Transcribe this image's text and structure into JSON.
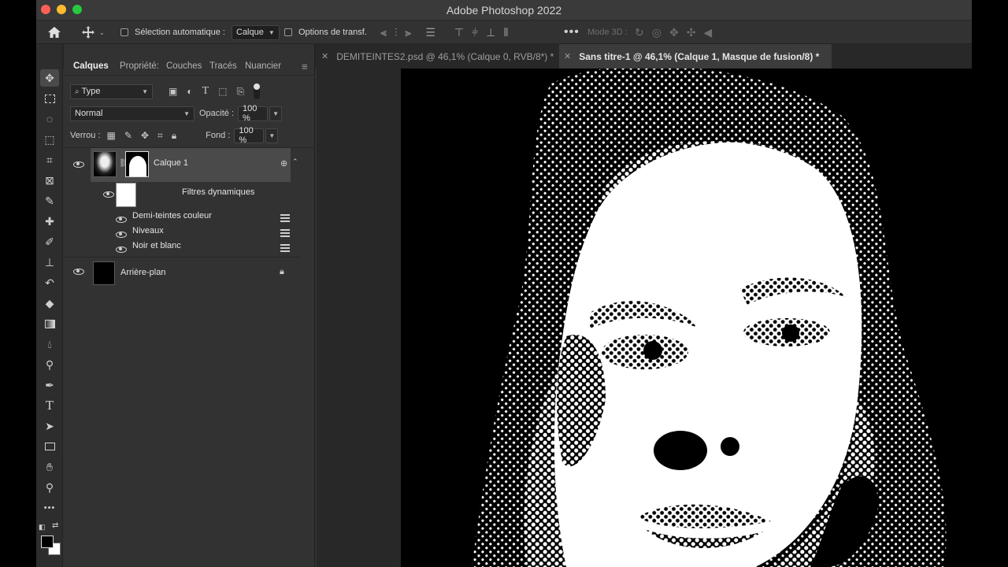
{
  "window": {
    "title": "Adobe Photoshop 2022"
  },
  "options_bar": {
    "auto_select_label": "Sélection automatique :",
    "auto_select_value": "Calque",
    "transform_label": "Options de transf.",
    "mode3d_label": "Mode 3D :"
  },
  "doc_tabs": [
    {
      "label": "DEMITEINTES2.psd @ 46,1% (Calque 0, RVB/8*) *"
    },
    {
      "label": "Sans titre-1 @ 46,1% (Calque 1, Masque de fusion/8) *"
    }
  ],
  "panel": {
    "tabs": [
      "Calques",
      "Propriété:",
      "Couches",
      "Tracés",
      "Nuancier"
    ],
    "filter_type": "Type",
    "blend_mode": "Normal",
    "opacity_label": "Opacité :",
    "opacity_value": "100 %",
    "lock_label": "Verrou :",
    "fill_label": "Fond :",
    "fill_value": "100 %"
  },
  "layers": {
    "layer1": {
      "name": "Calque 1"
    },
    "smart_filters": {
      "name": "Filtres dynamiques"
    },
    "filters": [
      {
        "name": "Demi-teintes couleur"
      },
      {
        "name": "Niveaux"
      },
      {
        "name": "Noir et blanc"
      }
    ],
    "background": {
      "name": "Arrière-plan"
    }
  },
  "colors": {
    "foreground": "#000000",
    "background": "#ffffff",
    "panel_bg": "#323232",
    "selected_layer_bg": "#4a4a4a"
  }
}
